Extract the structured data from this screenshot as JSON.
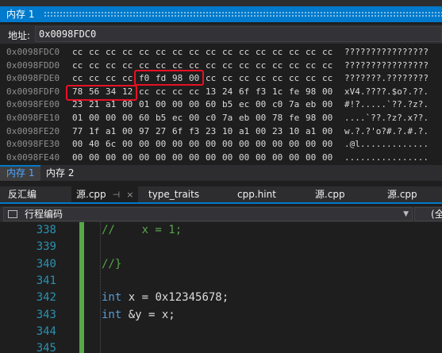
{
  "window": {
    "title": "内存 1"
  },
  "address": {
    "label": "地址:",
    "value": "0x0098FDC0"
  },
  "hex_rows": [
    {
      "addr": "0x0098FDC0",
      "bytes": [
        "cc",
        "cc",
        "cc",
        "cc",
        "cc",
        "cc",
        "cc",
        "cc",
        "cc",
        "cc",
        "cc",
        "cc",
        "cc",
        "cc",
        "cc",
        "cc"
      ],
      "ascii": "????????????????"
    },
    {
      "addr": "0x0098FDD0",
      "bytes": [
        "cc",
        "cc",
        "cc",
        "cc",
        "cc",
        "cc",
        "cc",
        "cc",
        "cc",
        "cc",
        "cc",
        "cc",
        "cc",
        "cc",
        "cc",
        "cc"
      ],
      "ascii": "????????????????"
    },
    {
      "addr": "0x0098FDE0",
      "bytes": [
        "cc",
        "cc",
        "cc",
        "cc",
        "f0",
        "fd",
        "98",
        "00",
        "cc",
        "cc",
        "cc",
        "cc",
        "cc",
        "cc",
        "cc",
        "cc"
      ],
      "ascii": "???????.????????"
    },
    {
      "addr": "0x0098FDF0",
      "bytes": [
        "78",
        "56",
        "34",
        "12",
        "cc",
        "cc",
        "cc",
        "cc",
        "13",
        "24",
        "6f",
        "f3",
        "1c",
        "fe",
        "98",
        "00"
      ],
      "ascii": "xV4.????.$o?.??."
    },
    {
      "addr": "0x0098FE00",
      "bytes": [
        "23",
        "21",
        "a1",
        "00",
        "01",
        "00",
        "00",
        "00",
        "60",
        "b5",
        "ec",
        "00",
        "c0",
        "7a",
        "eb",
        "00"
      ],
      "ascii": "#!?.....`??.?z?."
    },
    {
      "addr": "0x0098FE10",
      "bytes": [
        "01",
        "00",
        "00",
        "00",
        "60",
        "b5",
        "ec",
        "00",
        "c0",
        "7a",
        "eb",
        "00",
        "78",
        "fe",
        "98",
        "00"
      ],
      "ascii": "....`??.?z?.x??."
    },
    {
      "addr": "0x0098FE20",
      "bytes": [
        "77",
        "1f",
        "a1",
        "00",
        "97",
        "27",
        "6f",
        "f3",
        "23",
        "10",
        "a1",
        "00",
        "23",
        "10",
        "a1",
        "00"
      ],
      "ascii": "w.?.?'o?#.?.#.?."
    },
    {
      "addr": "0x0098FE30",
      "bytes": [
        "00",
        "40",
        "6c",
        "00",
        "00",
        "00",
        "00",
        "00",
        "00",
        "00",
        "00",
        "00",
        "00",
        "00",
        "00",
        "00"
      ],
      "ascii": ".@l............."
    },
    {
      "addr": "0x0098FE40",
      "bytes": [
        "00",
        "00",
        "00",
        "00",
        "00",
        "00",
        "00",
        "00",
        "00",
        "00",
        "00",
        "00",
        "00",
        "00",
        "00",
        "00"
      ],
      "ascii": "................"
    }
  ],
  "memory_tabs": [
    {
      "label": "内存 1",
      "active": true
    },
    {
      "label": "内存 2",
      "active": false
    }
  ],
  "doc_tabs": [
    {
      "label": "反汇编"
    },
    {
      "label": "源.cpp",
      "active": true,
      "pin": "⊣",
      "close": "×"
    },
    {
      "label": "type_traits"
    },
    {
      "label": "cpp.hint"
    },
    {
      "label": "源.cpp"
    },
    {
      "label": "源.cpp"
    }
  ],
  "nav": {
    "scope": "行程编码",
    "member": "(全"
  },
  "code_lines": [
    {
      "num": "338",
      "code": "//    x = 1;"
    },
    {
      "num": "339",
      "code": ""
    },
    {
      "num": "340",
      "code": "//}"
    },
    {
      "num": "341",
      "code": ""
    },
    {
      "num": "342",
      "code": "int x = 0x12345678;"
    },
    {
      "num": "343",
      "code": "int &y = x;"
    },
    {
      "num": "344",
      "code": ""
    },
    {
      "num": "345",
      "code": ""
    }
  ],
  "colors": {
    "accent": "#007acc",
    "highlight_box": "#e81123",
    "line_number": "#2b91af",
    "keyword": "#569cd6",
    "comment": "#57a64a",
    "change_bar": "#57a64a"
  }
}
